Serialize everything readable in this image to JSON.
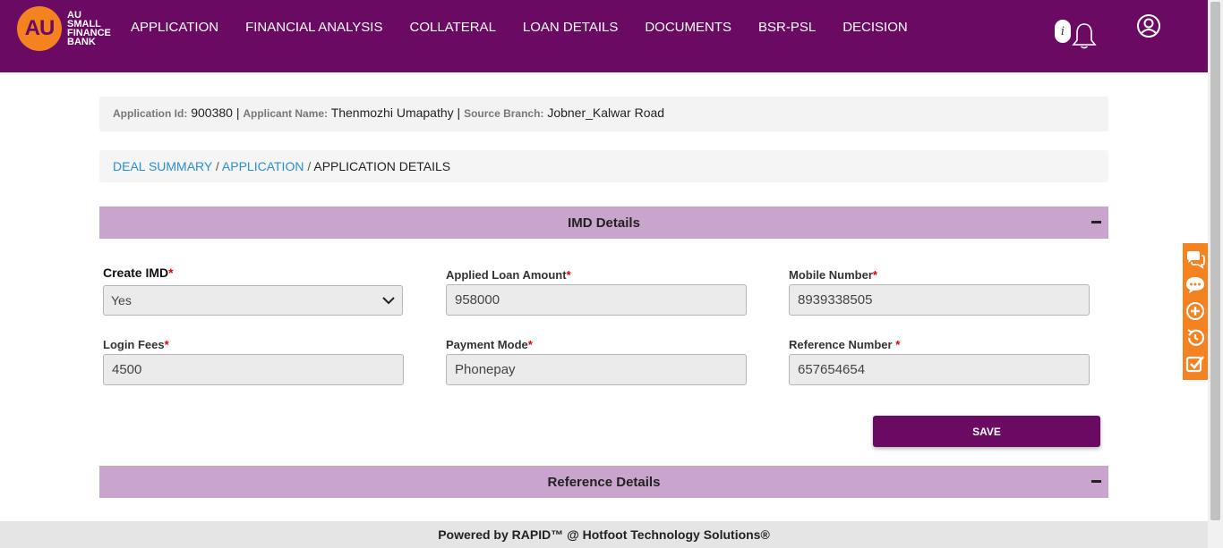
{
  "header": {
    "logo_mark": "AU",
    "logo_lines": [
      "AU",
      "SMALL",
      "FINANCE",
      "BANK"
    ],
    "nav": [
      "APPLICATION",
      "FINANCIAL ANALYSIS",
      "COLLATERAL",
      "LOAN DETAILS",
      "DOCUMENTS",
      "BSR-PSL",
      "DECISION"
    ],
    "info_glyph": "i",
    "icons": [
      "info-icon",
      "bell-icon",
      "user-icon"
    ],
    "brand_color": "#6b0a62",
    "accent_color": "#f58220"
  },
  "info_bar": {
    "application_id_label": "Application Id:",
    "application_id": "900380",
    "applicant_name_label": "Applicant Name:",
    "applicant_name": "Thenmozhi Umapathy",
    "source_branch_label": "Source Branch:",
    "source_branch": "Jobner_Kalwar Road",
    "separator": "|"
  },
  "breadcrumb": {
    "items": [
      "DEAL SUMMARY",
      "APPLICATION",
      "APPLICATION DETAILS"
    ],
    "separator": "/"
  },
  "imd": {
    "title": "IMD Details",
    "create_imd_label": "Create IMD",
    "create_imd_value": "Yes",
    "applied_loan_amount_label": "Applied Loan Amount",
    "applied_loan_amount": "958000",
    "mobile_number_label": "Mobile Number",
    "mobile_number": "8939338505",
    "login_fees_label": "Login Fees",
    "login_fees": "4500",
    "payment_mode_label": "Payment Mode",
    "payment_mode": "Phonepay",
    "reference_number_label": "Reference Number ",
    "reference_number": "657654654",
    "required_mark": "*",
    "save_label": "SAVE"
  },
  "reference": {
    "title": "Reference Details"
  },
  "side_toolbar": {
    "icons": [
      "chat-icon",
      "comment-icon",
      "add-icon",
      "history-icon",
      "checklist-icon"
    ],
    "color": "#f58220"
  },
  "footer": {
    "text": "Powered by RAPID™ @ Hotfoot Technology Solutions®"
  }
}
